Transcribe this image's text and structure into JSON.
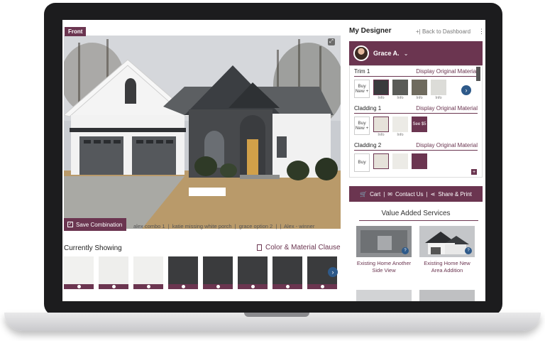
{
  "colors": {
    "brand": "#6b3550",
    "accent_blue": "#2e5a8a"
  },
  "hero": {
    "tag": "Front"
  },
  "left": {
    "save_label": "Save Combination",
    "combinations": [
      "alex combo 1",
      "|",
      "katie missing white porch",
      "|",
      "grace option 2",
      "|",
      "|",
      "Alex - winner"
    ],
    "currently_showing": "Currently Showing",
    "clause_label": "Color & Material Clause",
    "swatches": [
      {
        "color": "#f1f1ef",
        "icon": "info-icon"
      },
      {
        "color": "#eeeeec",
        "icon": "info-icon"
      },
      {
        "color": "#f0f0ee",
        "icon": "info-icon"
      },
      {
        "color": "#3b3c3e",
        "icon": "info-icon"
      },
      {
        "color": "#3a3b3d",
        "icon": "info-icon"
      },
      {
        "color": "#3c3d3f",
        "icon": "info-icon"
      },
      {
        "color": "#3b3c3e",
        "icon": "info-icon"
      },
      {
        "color": "#3a3b3d",
        "icon": "info-icon"
      }
    ]
  },
  "designer": {
    "title": "My Designer",
    "back": "+| Back to Dashboard",
    "kebab": "⋮",
    "user": "Grace A.",
    "groups": [
      {
        "name": "Trim 1",
        "orig": "Display Original Material",
        "buy": "Buy New +",
        "materials": [
          {
            "color": "#3a3b3d",
            "info": "Info"
          },
          {
            "color": "#5a5c58",
            "info": "Info"
          },
          {
            "color": "#6f6b5e",
            "info": "Info"
          },
          {
            "color": "#dcdcd8",
            "info": "Info"
          }
        ]
      },
      {
        "name": "Cladding 1",
        "orig": "Display Original Material",
        "buy": "Buy New +",
        "materials": [
          {
            "color": "#e6e2da",
            "info": "Info"
          },
          {
            "color": "#ecebe6",
            "info": "Info"
          }
        ],
        "see": "See $5"
      },
      {
        "name": "Cladding 2",
        "orig": "Display Original Material",
        "buy": "Buy"
      }
    ]
  },
  "actions": {
    "cart": "Cart",
    "sep": "|",
    "contact": "Contact Us",
    "share": "Share & Print"
  },
  "vas": {
    "title": "Value Added Services",
    "cards": [
      {
        "label": "Existing Home Another Side View"
      },
      {
        "label": "Existing Home New Area Addition"
      }
    ]
  }
}
